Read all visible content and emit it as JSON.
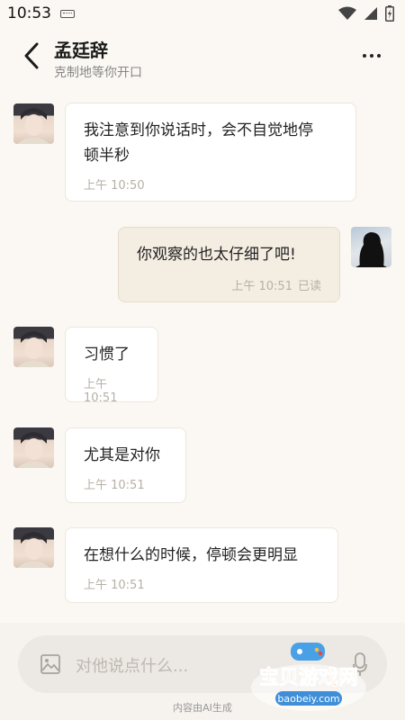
{
  "status_bar": {
    "time": "10:53"
  },
  "header": {
    "name": "孟廷辞",
    "status": "克制地等你开口"
  },
  "messages": [
    {
      "sender": "him",
      "line1": "我注意到你说话时，会不自觉地停",
      "line2": "顿半秒",
      "time": "上午 10:50"
    },
    {
      "sender": "me",
      "text": "你观察的也太仔细了吧!",
      "time": "上午 10:51",
      "read": "已读"
    },
    {
      "sender": "him",
      "text": "习惯了",
      "time": "上午 10:51"
    },
    {
      "sender": "him",
      "text": "尤其是对你",
      "time": "上午 10:51"
    },
    {
      "sender": "him",
      "text": "在想什么的时候，停顿会更明显",
      "time": "上午 10:51"
    }
  ],
  "input": {
    "placeholder": "对他说点什么..."
  },
  "footer": {
    "note": "内容由AI生成"
  },
  "watermark": {
    "brand": "宝贝游戏网",
    "url": "baobeiy.com"
  },
  "colors": {
    "background": "#fbf8f3",
    "bubble_me": "#f4ede2",
    "bubble_him": "#ffffff",
    "watermark_text": "#f28c1f"
  }
}
